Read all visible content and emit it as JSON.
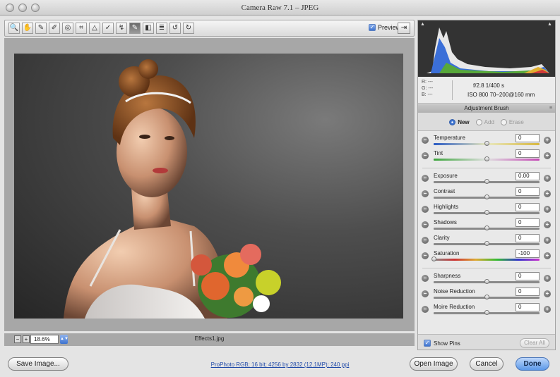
{
  "window": {
    "title": "Camera Raw 7.1  –  JPEG"
  },
  "toolbar": {
    "tools": [
      {
        "icon": "zoom-icon",
        "glyph": "🔍"
      },
      {
        "icon": "hand-icon",
        "glyph": "✋"
      },
      {
        "icon": "white-balance-icon",
        "glyph": "✎"
      },
      {
        "icon": "color-sampler-icon",
        "glyph": "✐"
      },
      {
        "icon": "target-adjustment-icon",
        "glyph": "◎"
      },
      {
        "icon": "crop-icon",
        "glyph": "⌗"
      },
      {
        "icon": "straighten-icon",
        "glyph": "△"
      },
      {
        "icon": "spot-removal-icon",
        "glyph": "✓"
      },
      {
        "icon": "red-eye-icon",
        "glyph": "↯"
      },
      {
        "icon": "adjustment-brush-icon",
        "glyph": "✎"
      },
      {
        "icon": "graduated-filter-icon",
        "glyph": "◧"
      },
      {
        "icon": "preferences-icon",
        "glyph": "≣"
      },
      {
        "icon": "rotate-left-icon",
        "glyph": "↺"
      },
      {
        "icon": "rotate-right-icon",
        "glyph": "↻"
      }
    ],
    "preview_label": "Preview",
    "preview_checked": true,
    "fullscreen_icon": "fullscreen-toggle-icon"
  },
  "canvas": {
    "zoom": "18.6%",
    "filename": "Effects1.jpg"
  },
  "info": {
    "r": "R:  ---",
    "g": "G:  ---",
    "b": "B:  ---",
    "exif_line1": "f/2.8   1/400 s",
    "exif_line2": "ISO 800   70–200@160 mm"
  },
  "panel": {
    "title": "Adjustment Brush",
    "modes": [
      {
        "label": "New",
        "selected": true
      },
      {
        "label": "Add",
        "selected": false
      },
      {
        "label": "Erase",
        "selected": false
      }
    ],
    "sliders": [
      {
        "label": "Temperature",
        "value": "0",
        "level": 0.5,
        "track": "temp"
      },
      {
        "label": "Tint",
        "value": "0",
        "level": 0.5,
        "track": "tint"
      },
      {
        "label": "Exposure",
        "value": "0.00",
        "level": 0.5,
        "track": "plain"
      },
      {
        "label": "Contrast",
        "value": "0",
        "level": 0.5,
        "track": "plain"
      },
      {
        "label": "Highlights",
        "value": "0",
        "level": 0.5,
        "track": "plain"
      },
      {
        "label": "Shadows",
        "value": "0",
        "level": 0.5,
        "track": "plain"
      },
      {
        "label": "Clarity",
        "value": "0",
        "level": 0.5,
        "track": "plain"
      },
      {
        "label": "Saturation",
        "value": "-100",
        "level": 0.0,
        "track": "sat"
      },
      {
        "label": "Sharpness",
        "value": "0",
        "level": 0.5,
        "track": "plain"
      },
      {
        "label": "Noise Reduction",
        "value": "0",
        "level": 0.5,
        "track": "plain"
      },
      {
        "label": "Moire Reduction",
        "value": "0",
        "level": 0.5,
        "track": "plain"
      }
    ],
    "show_pins_label": "Show Pins",
    "show_pins_checked": true,
    "clear_all_label": "Clear All"
  },
  "footer": {
    "save_label": "Save Image...",
    "workflow_link": "ProPhoto RGB; 16 bit; 4256 by 2832 (12.1MP); 240 ppi",
    "open_label": "Open Image",
    "cancel_label": "Cancel",
    "done_label": "Done"
  }
}
